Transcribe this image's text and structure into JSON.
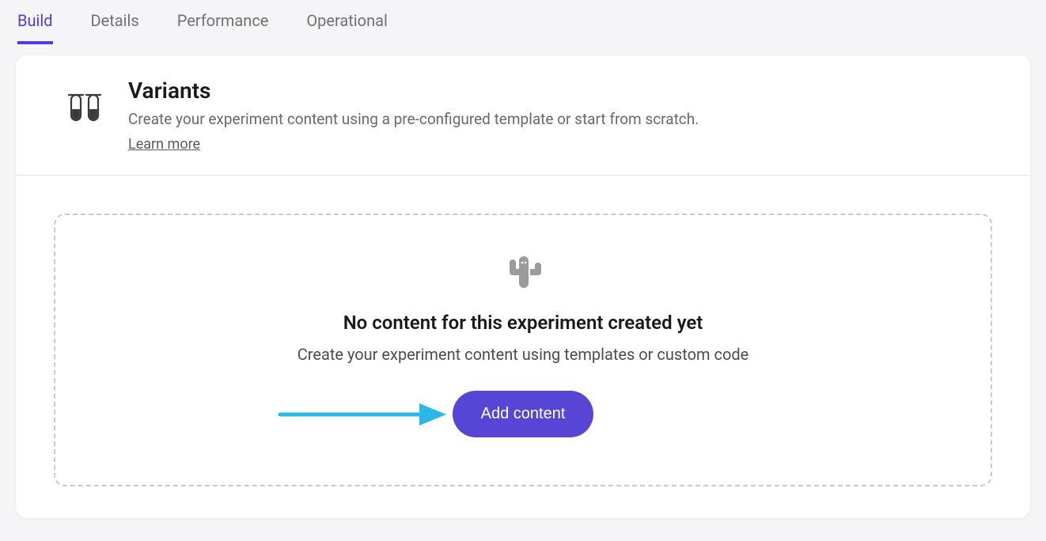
{
  "tabs": {
    "build": "Build",
    "details": "Details",
    "performance": "Performance",
    "operational": "Operational",
    "active": "build"
  },
  "variants": {
    "title": "Variants",
    "subtitle": "Create your experiment content using a pre-configured template or start from scratch.",
    "learnMore": "Learn more"
  },
  "empty": {
    "title": "No content for this experiment created yet",
    "subtitle": "Create your experiment content using templates or custom code",
    "addButton": "Add content"
  },
  "colors": {
    "accent": "#5746d6",
    "annotationArrow": "#29b8e8"
  }
}
